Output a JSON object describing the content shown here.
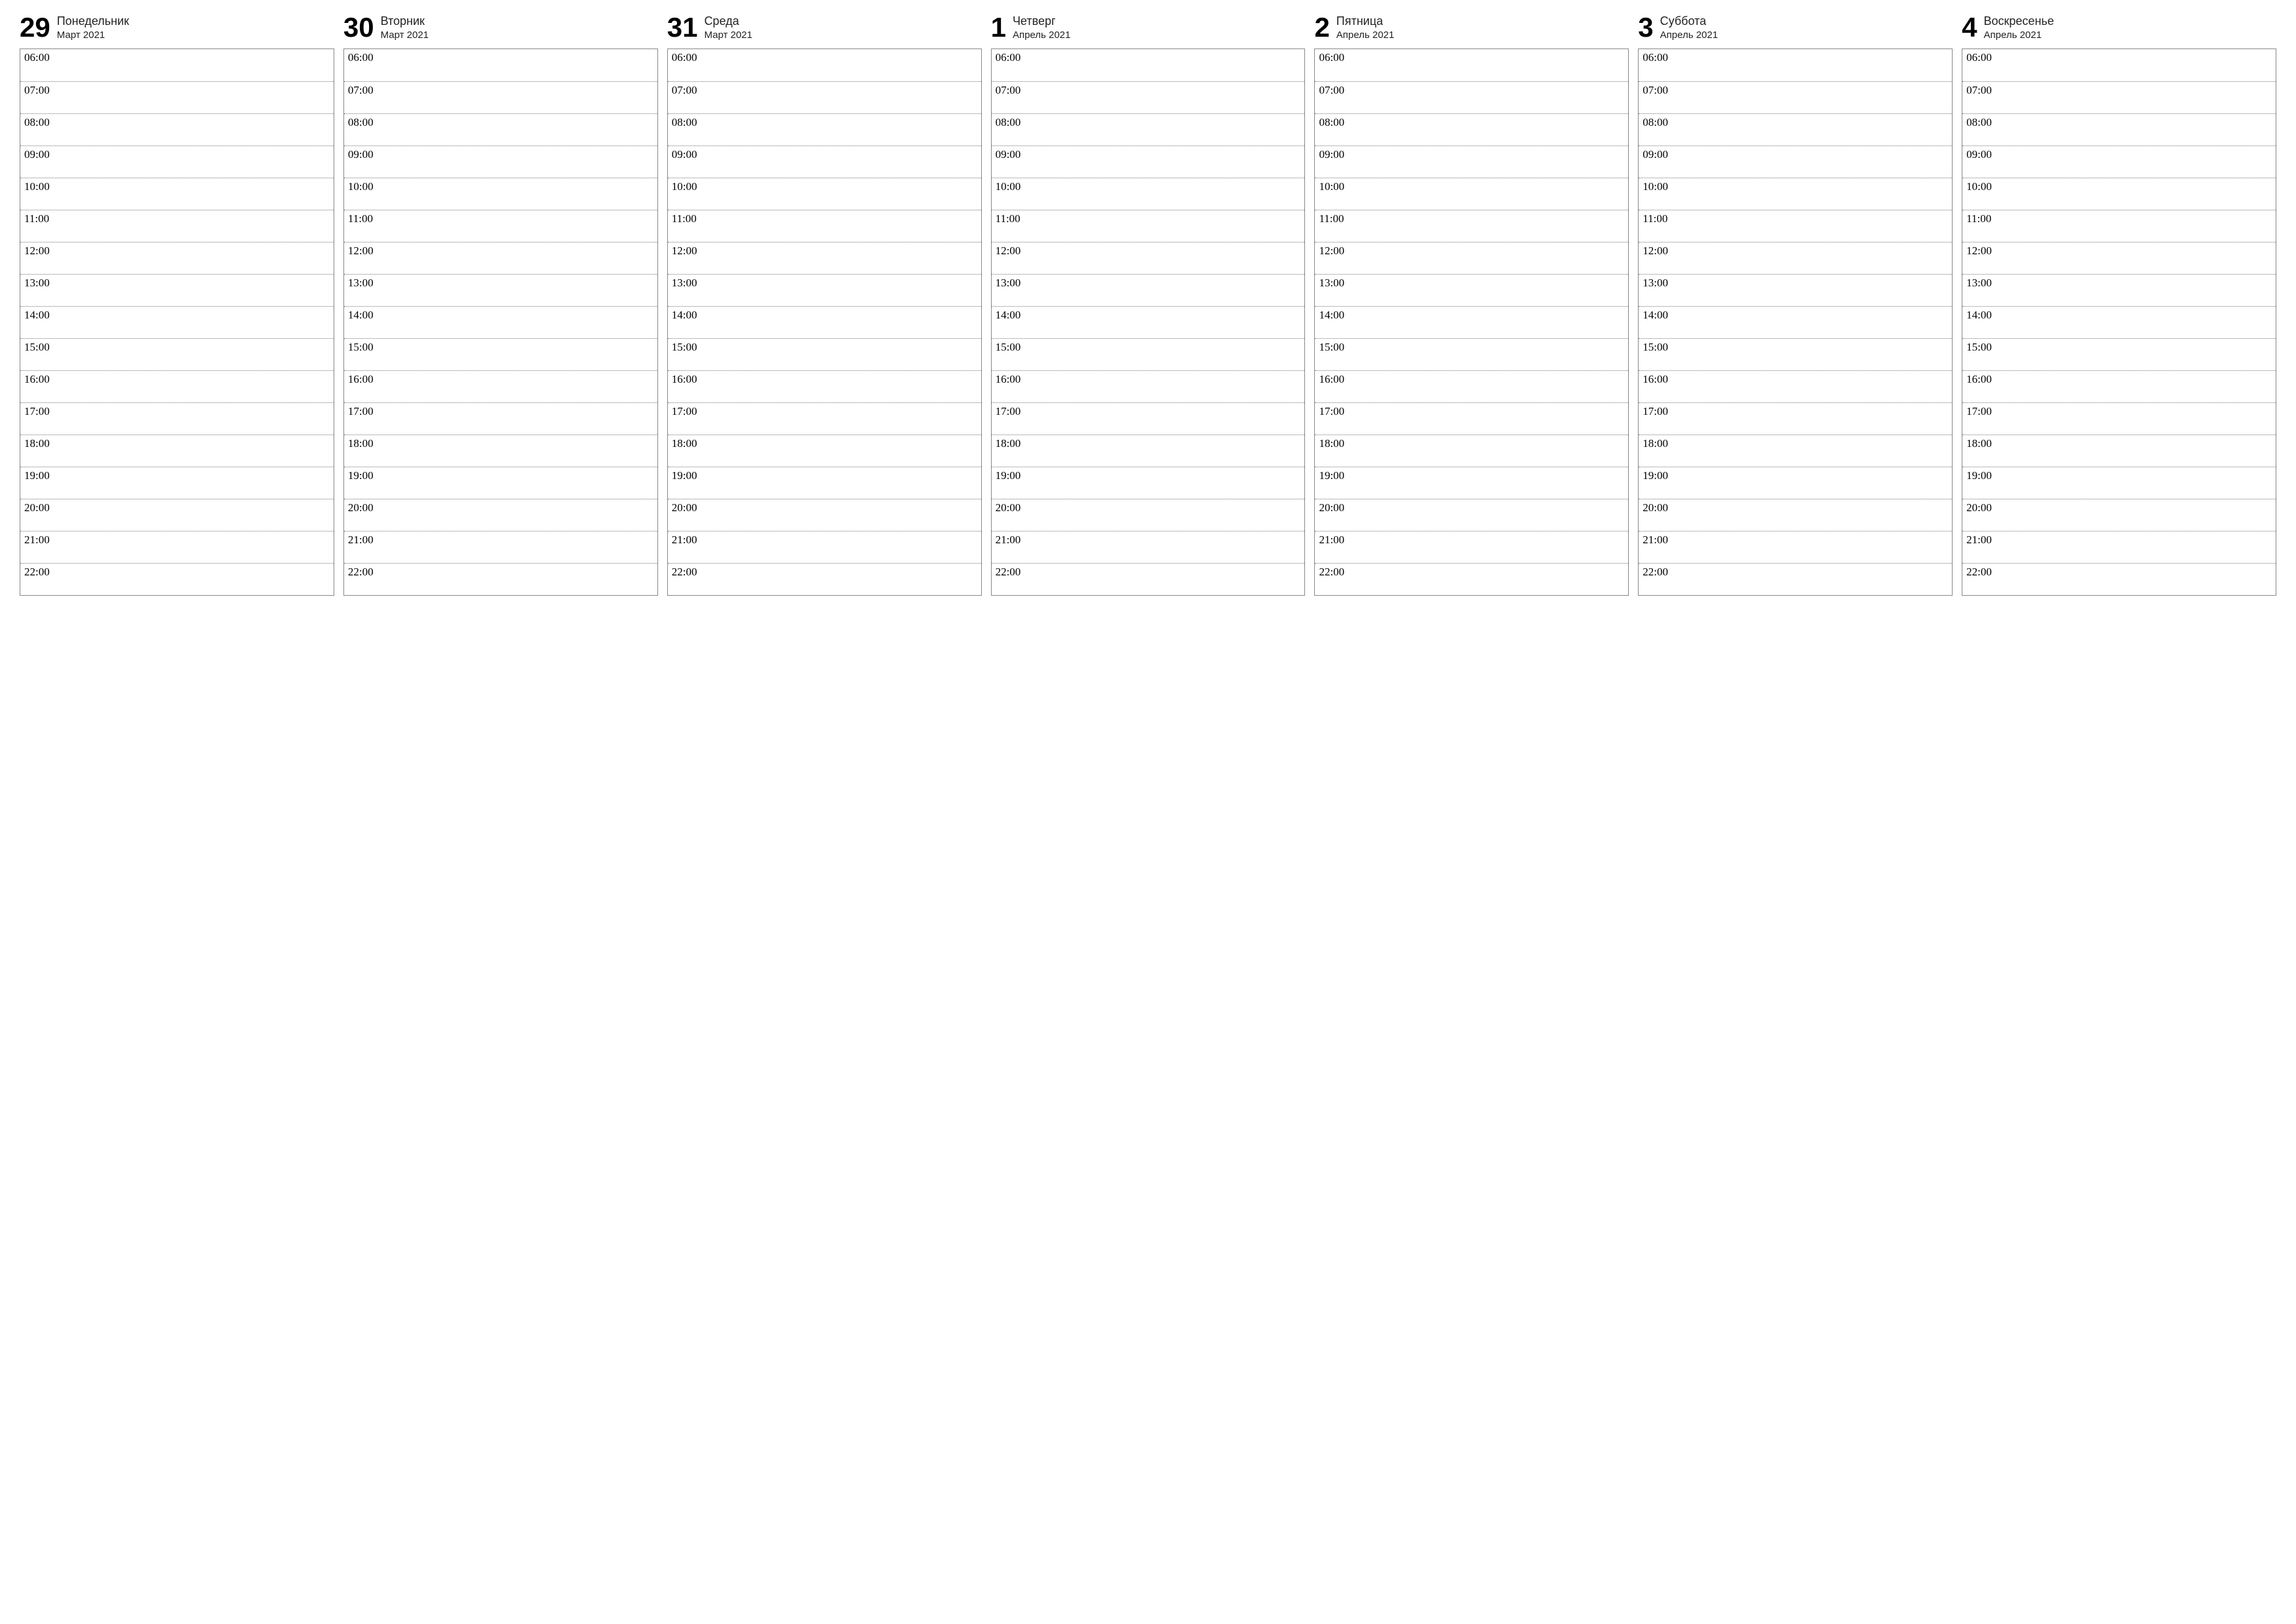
{
  "hours": [
    "06:00",
    "07:00",
    "08:00",
    "09:00",
    "10:00",
    "11:00",
    "12:00",
    "13:00",
    "14:00",
    "15:00",
    "16:00",
    "17:00",
    "18:00",
    "19:00",
    "20:00",
    "21:00",
    "22:00"
  ],
  "days": [
    {
      "num": "29",
      "name": "Понедельник",
      "month": "Март 2021"
    },
    {
      "num": "30",
      "name": "Вторник",
      "month": "Март 2021"
    },
    {
      "num": "31",
      "name": "Среда",
      "month": "Март 2021"
    },
    {
      "num": "1",
      "name": "Четверг",
      "month": "Апрель 2021"
    },
    {
      "num": "2",
      "name": "Пятница",
      "month": "Апрель 2021"
    },
    {
      "num": "3",
      "name": "Суббота",
      "month": "Апрель 2021"
    },
    {
      "num": "4",
      "name": "Воскресенье",
      "month": "Апрель 2021"
    }
  ]
}
